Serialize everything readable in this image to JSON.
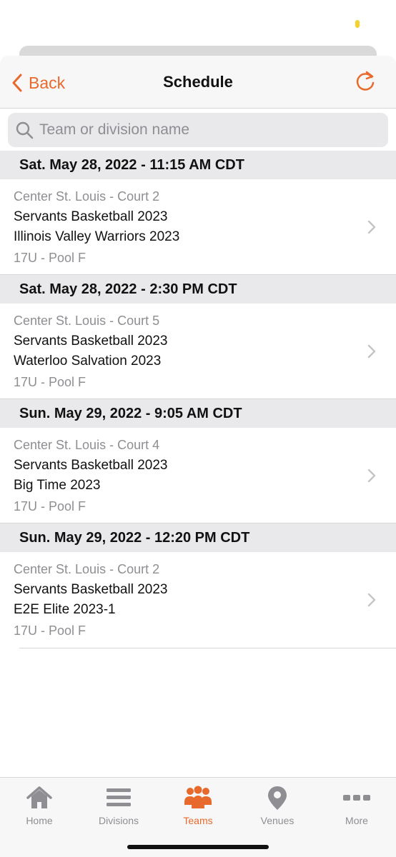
{
  "nav": {
    "back_label": "Back",
    "title": "Schedule",
    "accent_color": "#e8692c"
  },
  "search": {
    "placeholder": "Team or division name",
    "value": ""
  },
  "sections": [
    {
      "header": "Sat. May 28, 2022 - 11:15 AM CDT",
      "venue": "Center St. Louis - Court 2",
      "team1": "Servants Basketball 2023",
      "team2": "Illinois Valley Warriors 2023",
      "division": "17U - Pool F"
    },
    {
      "header": "Sat. May 28, 2022 - 2:30 PM CDT",
      "venue": "Center St. Louis - Court 5",
      "team1": "Servants Basketball 2023",
      "team2": "Waterloo Salvation 2023",
      "division": "17U - Pool F"
    },
    {
      "header": "Sun. May 29, 2022 - 9:05 AM CDT",
      "venue": "Center St. Louis - Court 4",
      "team1": "Servants Basketball 2023",
      "team2": "Big Time 2023",
      "division": "17U - Pool F"
    },
    {
      "header": "Sun. May 29, 2022 - 12:20 PM CDT",
      "venue": "Center St. Louis - Court 2",
      "team1": "Servants Basketball 2023",
      "team2": "E2E Elite 2023-1",
      "division": "17U - Pool F"
    }
  ],
  "tabs": [
    {
      "label": "Home",
      "icon": "home-icon",
      "active": false
    },
    {
      "label": "Divisions",
      "icon": "list-icon",
      "active": false
    },
    {
      "label": "Teams",
      "icon": "people-icon",
      "active": true
    },
    {
      "label": "Venues",
      "icon": "map-pin-icon",
      "active": false
    },
    {
      "label": "More",
      "icon": "more-dots-icon",
      "active": false
    }
  ]
}
